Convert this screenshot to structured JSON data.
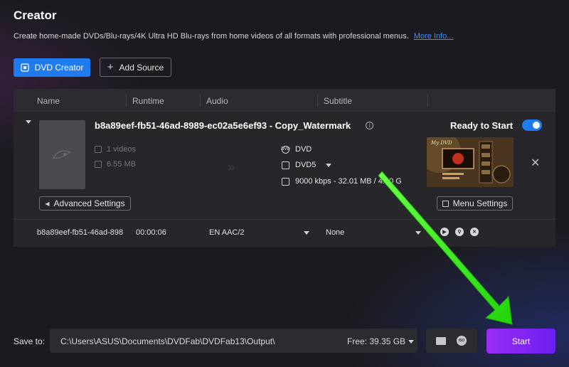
{
  "header": {
    "title": "Creator",
    "description": "Create home-made DVDs/Blu-rays/4K Ultra HD Blu-rays from home videos of all formats with professional menus.",
    "more_info_link": "More Info..."
  },
  "toolbar": {
    "mode_button_label": "DVD Creator",
    "add_source_label": "Add Source"
  },
  "table": {
    "columns": [
      "Name",
      "Runtime",
      "Audio",
      "Subtitle"
    ]
  },
  "item": {
    "title": "b8a89eef-fb51-46ad-8989-ec02a5e6ef93 - Copy_Watermark",
    "videos_count": "1 videos",
    "size": "6.55 MB",
    "output_format": "DVD",
    "disc_type": "DVD5",
    "bitrate_info": "9000 kbps - 32.01 MB / 4.20 G",
    "status": "Ready to Start",
    "advanced_settings_label": "Advanced Settings",
    "menu_settings_label": "Menu Settings",
    "menu_thumb_caption": "My DVD"
  },
  "track_row": {
    "name": "b8a89eef-fb51-46ad-898",
    "runtime": "00:00:06",
    "audio": "EN  AAC/2",
    "subtitle": "None"
  },
  "footer": {
    "save_to_label": "Save to:",
    "path": "C:\\Users\\ASUS\\Documents\\DVDFab\\DVDFab13\\Output\\",
    "free_space": "Free: 39.35 GB",
    "start_label": "Start",
    "iso_icon_text": "ISO"
  },
  "colors": {
    "accent_blue": "#1e7bf0",
    "start_purple": "#8a26f2",
    "annotation_arrow": "#35e61c"
  }
}
